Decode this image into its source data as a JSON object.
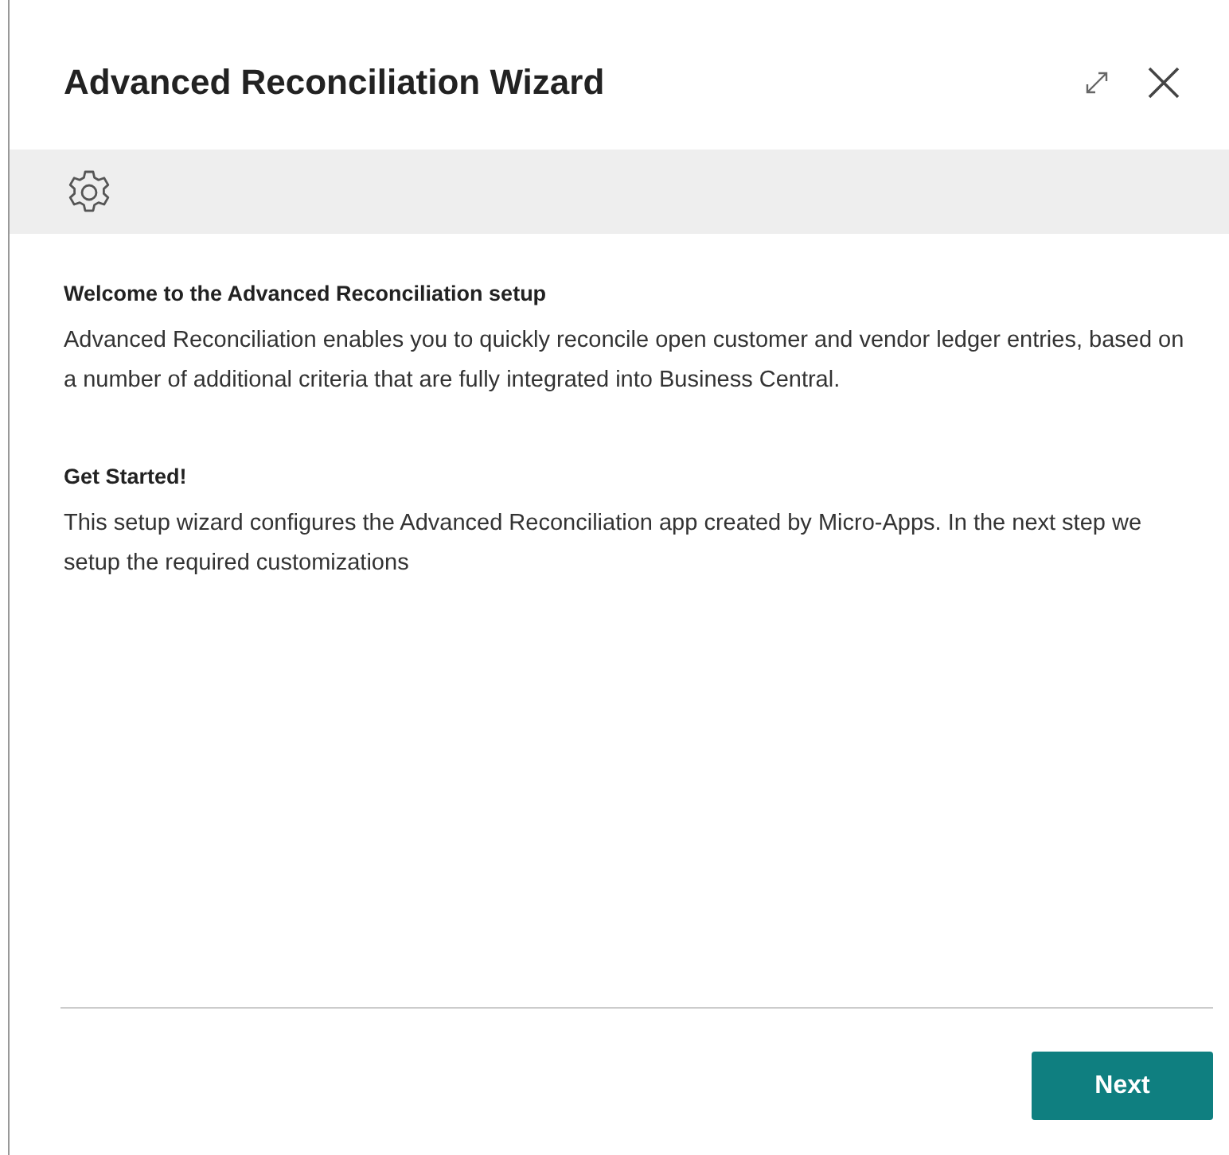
{
  "window": {
    "title": "Advanced Reconciliation Wizard"
  },
  "sections": [
    {
      "heading": "Welcome to the Advanced Reconciliation setup",
      "text": "Advanced Reconciliation enables you to quickly reconcile open customer and vendor ledger entries, based on a number of additional criteria that are fully integrated into Business Central."
    },
    {
      "heading": "Get Started!",
      "text": "This setup wizard configures the Advanced Reconciliation app created by Micro-Apps. In the next step we setup the required customizations"
    }
  ],
  "buttons": [
    "Next"
  ]
}
